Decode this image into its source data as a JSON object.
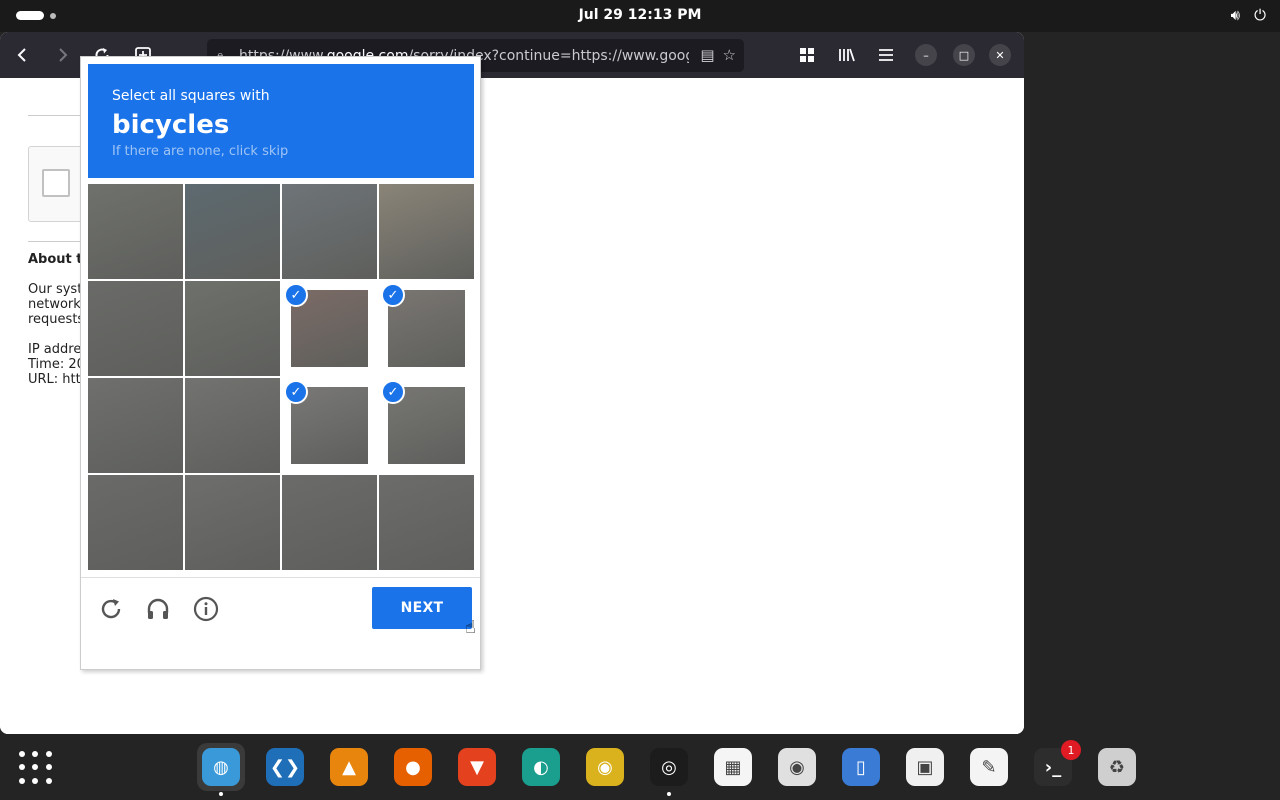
{
  "topbar": {
    "clock": "Jul 29  12:13 PM"
  },
  "browser": {
    "url_prefix": "https://www.",
    "url_domain": "google.com",
    "url_rest": "/sorry/index?continue=https://www.google.cc"
  },
  "page": {
    "about": "About th",
    "lines": [
      "Our syst",
      "network.",
      "requests",
      "IP addres",
      "Time: 20",
      "URL: http"
    ]
  },
  "captcha": {
    "line1": "Select all squares with",
    "target": "bicycles",
    "hint": "If there are none, click skip",
    "next_label": "NEXT",
    "selected": [
      6,
      7,
      10,
      11
    ],
    "tile_colors": [
      "#6f716c",
      "#5d6a70",
      "#6e7478",
      "#8a8478",
      "#6a6b68",
      "#6d706b",
      "#7b6b66",
      "#7a7672",
      "#6f706e",
      "#727370",
      "#797876",
      "#777673",
      "#6a6a69",
      "#6e6e6c",
      "#6b6b6a",
      "#6c6c6b"
    ]
  },
  "dock": {
    "badge": "1",
    "apps": [
      {
        "name": "web-browser",
        "color": "#3a9ad9",
        "glyph": "◍"
      },
      {
        "name": "vscode",
        "color": "#1e6fb8",
        "glyph": "❮❯"
      },
      {
        "name": "vlc",
        "color": "#e8850c",
        "glyph": "▲"
      },
      {
        "name": "firefox",
        "color": "#e66000",
        "glyph": "●"
      },
      {
        "name": "brave",
        "color": "#e4411e",
        "glyph": "▼"
      },
      {
        "name": "edge-dev",
        "color": "#1a9e8e",
        "glyph": "◐"
      },
      {
        "name": "chrome-dev",
        "color": "#d9b21e",
        "glyph": "◉"
      },
      {
        "name": "obs",
        "color": "#1c1c1c",
        "glyph": "◎"
      },
      {
        "name": "calendar",
        "color": "#f5f5f5",
        "glyph": "▦"
      },
      {
        "name": "rhythmbox",
        "color": "#e0e0e0",
        "glyph": "◉"
      },
      {
        "name": "files",
        "color": "#3a7bd5",
        "glyph": "▯"
      },
      {
        "name": "software",
        "color": "#f0f0f0",
        "glyph": "▣"
      },
      {
        "name": "text-editor",
        "color": "#f4f4f4",
        "glyph": "✎"
      },
      {
        "name": "terminal",
        "color": "#2d2d2d",
        "glyph": "›_"
      },
      {
        "name": "trash",
        "color": "#cfcfcf",
        "glyph": "♻"
      }
    ]
  }
}
